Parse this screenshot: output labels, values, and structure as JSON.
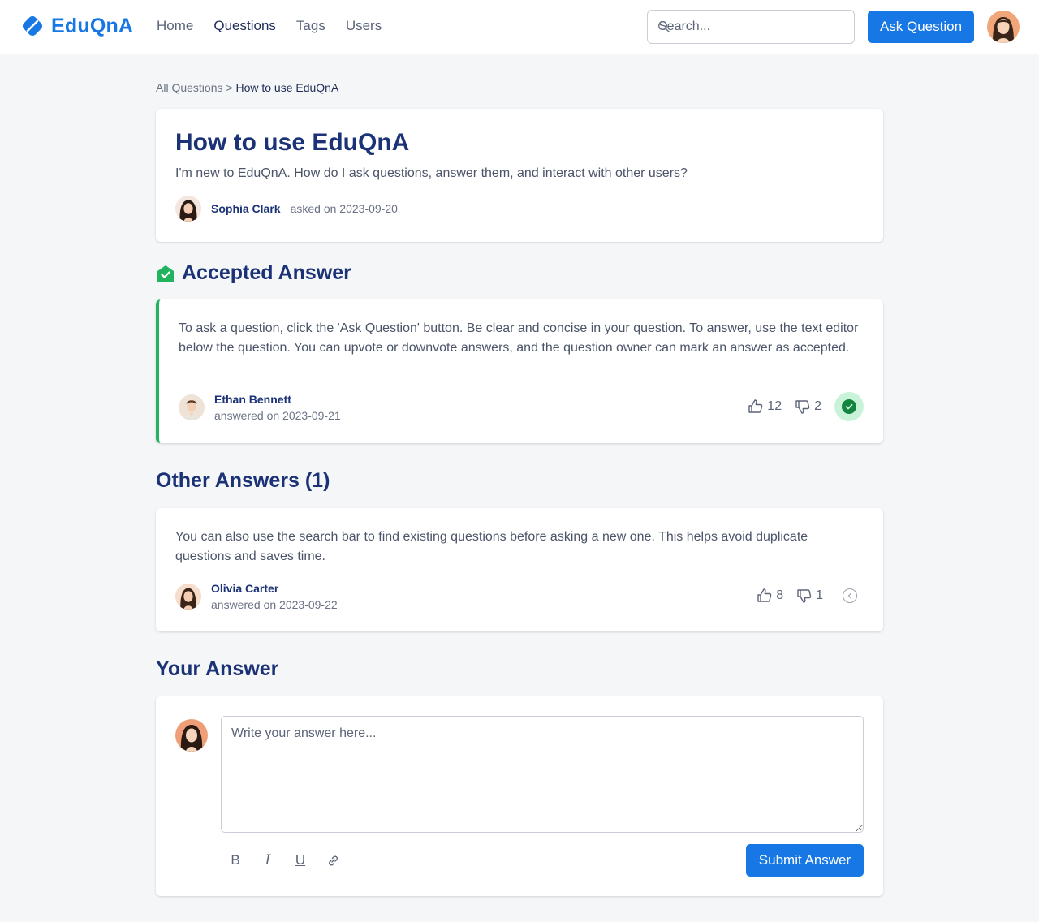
{
  "header": {
    "brand": "EduQnA",
    "nav": [
      {
        "label": "Home"
      },
      {
        "label": "Questions"
      },
      {
        "label": "Tags"
      },
      {
        "label": "Users"
      }
    ],
    "search_placeholder": "Search...",
    "ask_button": "Ask Question",
    "accent_color": "#1677e5"
  },
  "breadcrumb": {
    "parent": "All Questions",
    "separator": ">",
    "current": "How to use EduQnA"
  },
  "question": {
    "title": "How to use EduQnA",
    "body": "I'm new to EduQnA. How do I ask questions, answer them, and interact with other users?",
    "author": "Sophia Clark",
    "date_text": "asked on 2023-09-20"
  },
  "accepted": {
    "heading": "Accepted Answer",
    "body": "To ask a question, click the 'Ask Question' button. Be clear and concise in your question. To answer, use the text editor below the question. You can upvote or downvote answers, and the question owner can mark an answer as accepted.",
    "author": "Ethan Bennett",
    "date_text": "answered on 2023-09-21",
    "upvotes": "12",
    "downvotes": "2",
    "accent_color": "#22b35e"
  },
  "other": {
    "heading": "Other Answers (1)",
    "answers": [
      {
        "body": "You can also use the search bar to find existing questions before asking a new one. This helps avoid duplicate questions and saves time.",
        "author": "Olivia Carter",
        "date_text": "answered on 2023-09-22",
        "upvotes": "8",
        "downvotes": "1"
      }
    ]
  },
  "your_answer": {
    "heading": "Your Answer",
    "placeholder": "Write your answer here...",
    "tools": [
      {
        "label": "B",
        "icon": "bold-icon"
      },
      {
        "label": "I",
        "icon": "italic-icon"
      },
      {
        "label": "U",
        "icon": "underline-icon"
      },
      {
        "icon": "link-icon"
      }
    ],
    "submit": "Submit Answer"
  }
}
